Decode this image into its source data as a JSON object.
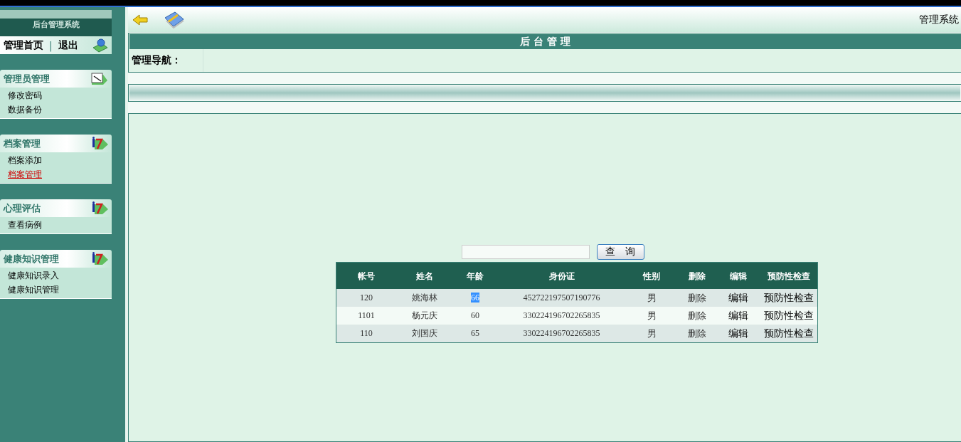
{
  "sidebar": {
    "title": "后台管理系统",
    "top_links": [
      "管理首页",
      "退出"
    ],
    "separator": "|",
    "sections": [
      {
        "title": "管理员管理",
        "items": [
          {
            "label": "修改密码",
            "selected": false
          },
          {
            "label": "数据备份",
            "selected": false
          }
        ]
      },
      {
        "title": "档案管理",
        "items": [
          {
            "label": "档案添加",
            "selected": false
          },
          {
            "label": "档案管理",
            "selected": true
          }
        ]
      },
      {
        "title": "心理评估",
        "items": [
          {
            "label": "查看病例",
            "selected": false
          }
        ]
      },
      {
        "title": "健康知识管理",
        "items": [
          {
            "label": "健康知识录入",
            "selected": false
          },
          {
            "label": "健康知识管理",
            "selected": false
          }
        ]
      }
    ]
  },
  "toolbar": {
    "right_text": "管理系统"
  },
  "panel": {
    "title": "后 台 管 理",
    "nav_label": "管理导航："
  },
  "search": {
    "button": "查　询"
  },
  "table": {
    "columns": [
      "帐号",
      "姓名",
      "年龄",
      "身份证",
      "性别",
      "删除",
      "编辑",
      "预防性检查"
    ],
    "rows": [
      {
        "cells": [
          "120",
          "姚海林",
          "66",
          "452722197507190776",
          "男",
          "删除",
          "编辑",
          "预防性检查"
        ],
        "age_highlighted": true
      },
      {
        "cells": [
          "1101",
          "杨元庆",
          "60",
          "330224196702265835",
          "男",
          "删除",
          "编辑",
          "预防性检查"
        ],
        "age_highlighted": false
      },
      {
        "cells": [
          "110",
          "刘国庆",
          "65",
          "330224196702265835",
          "男",
          "删除",
          "编辑",
          "预防性检查"
        ],
        "age_highlighted": false
      }
    ]
  }
}
